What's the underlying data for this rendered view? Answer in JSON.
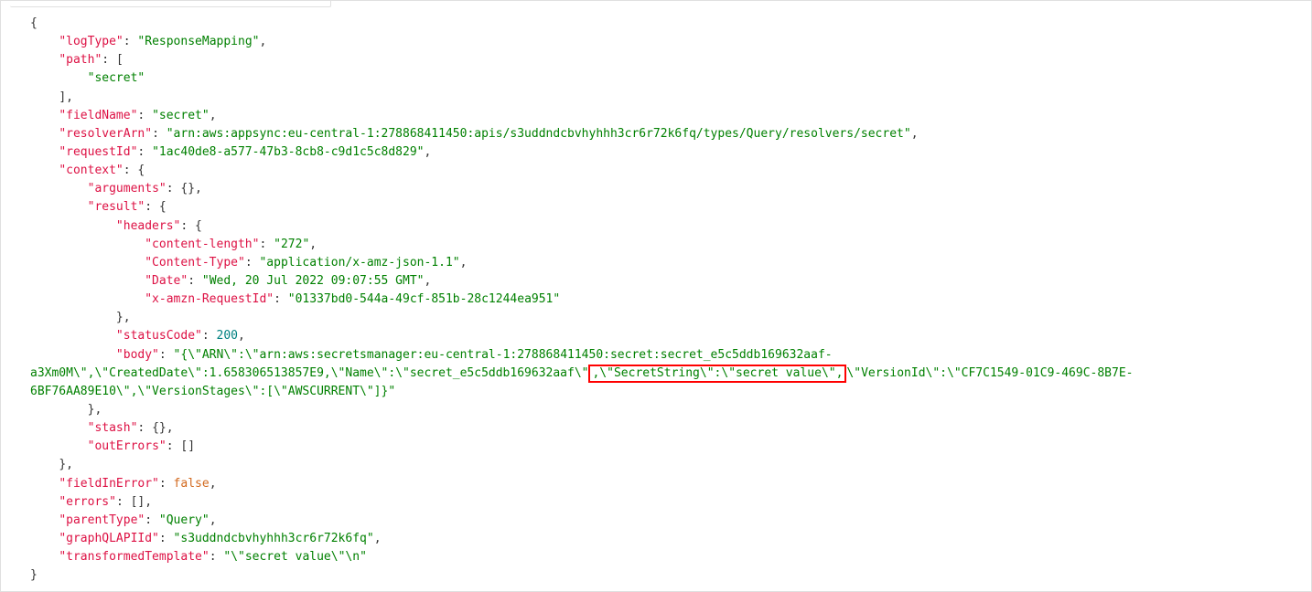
{
  "logType": "ResponseMapping",
  "path_item": "secret",
  "fieldName": "secret",
  "resolverArn": "arn:aws:appsync:eu-central-1:278868411450:apis/s3uddndcbvhyhhh3cr6r72k6fq/types/Query/resolvers/secret",
  "requestId": "1ac40de8-a577-47b3-8cb8-c9d1c5c8d829",
  "headers": {
    "content_length": "272",
    "content_type": "application/x-amz-json-1.1",
    "date": "Wed, 20 Jul 2022 09:07:55 GMT",
    "x_amzn_RequestId": "01337bd0-544a-49cf-851b-28c1244ea951"
  },
  "statusCode": "200",
  "body_prefix": "{\\\"ARN\\\":\\\"arn:aws:secretsmanager:eu-central-1:278868411450:secret:secret_e5c5ddb169632aaf-a3Xm0M\\\",\\\"CreatedDate\\\":1.658306513857E9,\\\"Name\\\":\\\"secret_e5c5ddb169632aaf\\\"",
  "body_highlight": ",\\\"SecretString\\\":\\\"secret value\\\",",
  "body_suffix": "\\\"VersionId\\\":\\\"CF7C1549-01C9-469C-8B7E-6BF76AA89E10\\\",\\\"VersionStages\\\":[\\\"AWSCURRENT\\\"]}",
  "fieldInError": "false",
  "parentType": "Query",
  "graphQLAPIId": "s3uddndcbvhyhhh3cr6r72k6fq",
  "transformedTemplate": "\\\"secret value\\\"\\n"
}
